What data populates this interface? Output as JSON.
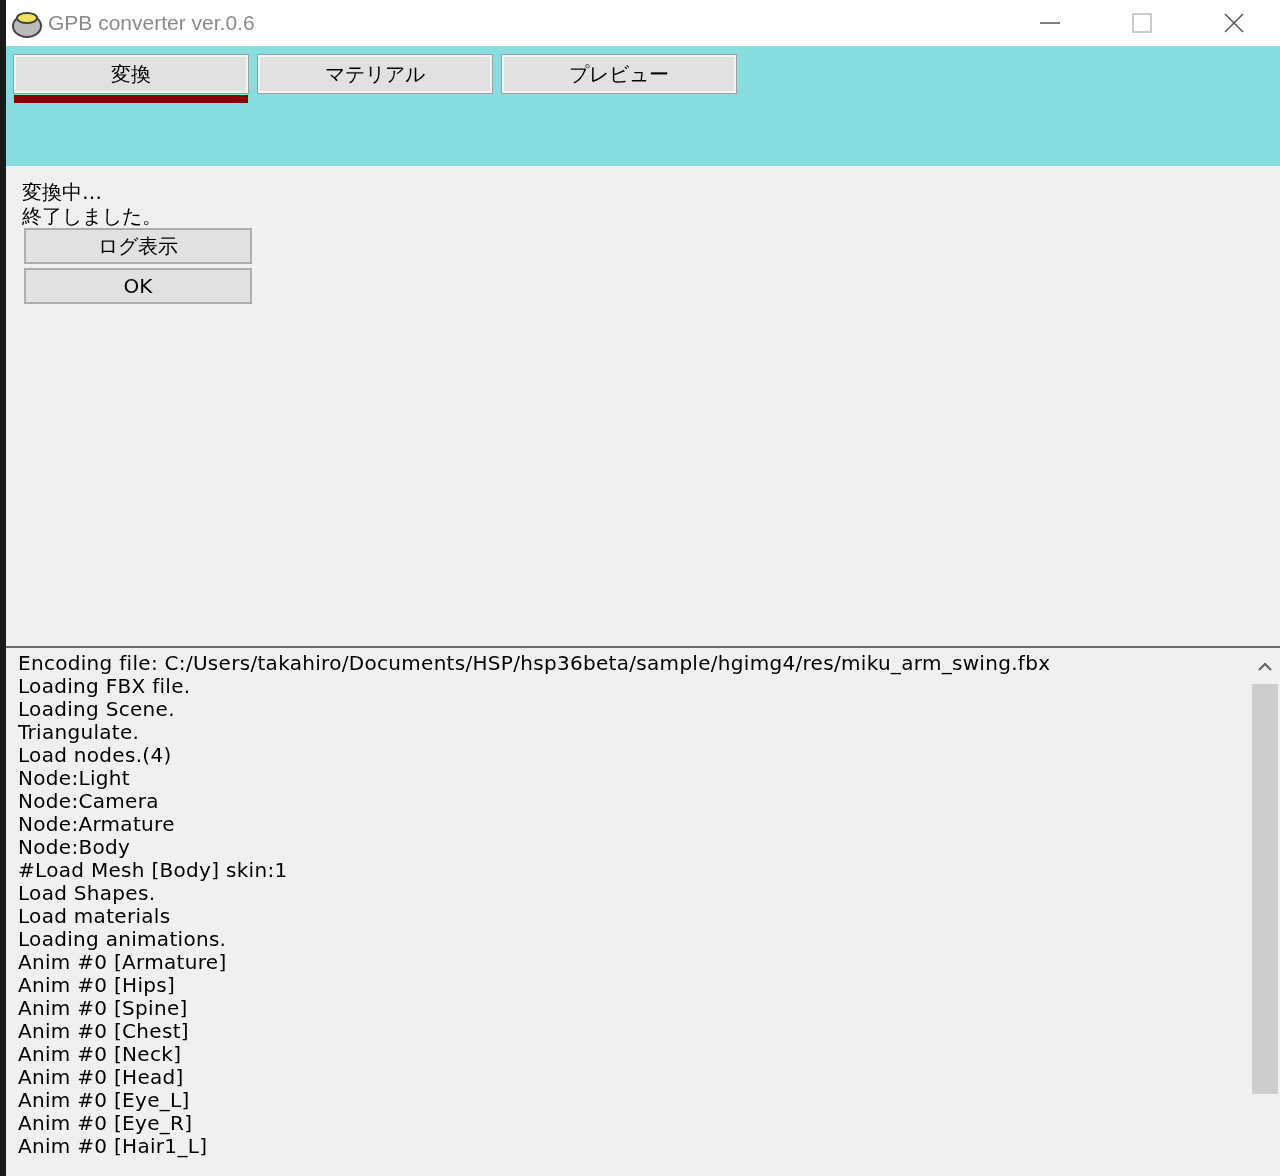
{
  "window": {
    "title": "GPB converter ver.0.6"
  },
  "tabs": [
    {
      "label": "変換",
      "selected": true
    },
    {
      "label": "マテリアル",
      "selected": false
    },
    {
      "label": "プレビュー",
      "selected": false
    }
  ],
  "status_lines": [
    "変換中…",
    "終了しました。"
  ],
  "buttons": [
    "ログ表示",
    "OK"
  ],
  "log": {
    "lines": [
      "Encoding file: C:/Users/takahiro/Documents/HSP/hsp36beta/sample/hgimg4/res/miku_arm_swing.fbx",
      "Loading FBX file.",
      "Loading Scene.",
      "Triangulate.",
      "Load nodes.(4)",
      "Node:Light",
      "Node:Camera",
      "Node:Armature",
      "Node:Body",
      "#Load Mesh [Body] skin:1",
      "Load Shapes.",
      "Load materials",
      "Loading animations.",
      "Anim #0 [Armature]",
      "Anim #0 [Hips]",
      "Anim #0 [Spine]",
      "Anim #0 [Chest]",
      "Anim #0 [Neck]",
      "Anim #0 [Head]",
      "Anim #0 [Eye_L]",
      "Anim #0 [Eye_R]",
      "Anim #0 [Hair1_L]"
    ]
  }
}
